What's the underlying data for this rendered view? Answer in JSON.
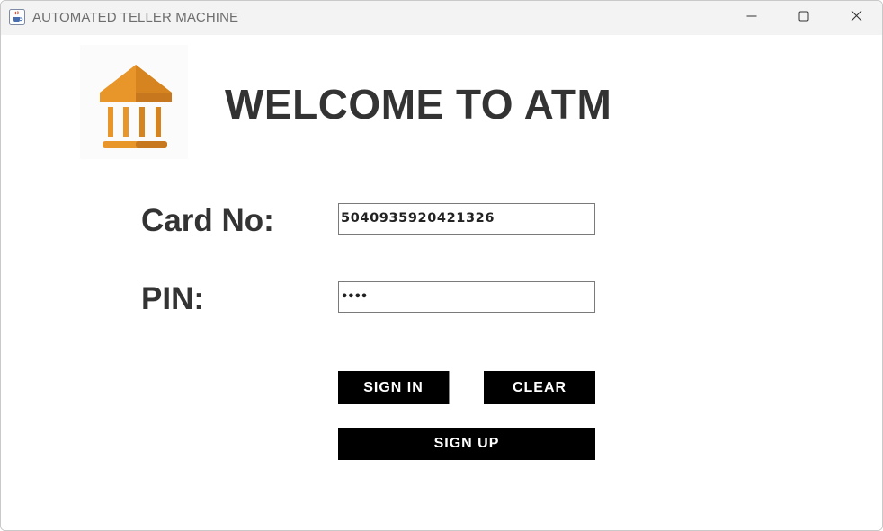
{
  "window": {
    "title": "AUTOMATED TELLER MACHINE",
    "app_icon": "java-cup-icon",
    "controls": {
      "minimize_icon": "minimize-icon",
      "maximize_icon": "maximize-icon",
      "close_icon": "close-icon"
    }
  },
  "header": {
    "logo_icon": "bank-icon",
    "title": "WELCOME TO ATM"
  },
  "form": {
    "card_label": "Card No:",
    "card_value": "5040935920421326",
    "pin_label": "PIN:",
    "pin_value": "••••"
  },
  "buttons": {
    "sign_in": "SIGN IN",
    "clear": "CLEAR",
    "sign_up": "SIGN UP"
  },
  "colors": {
    "logo_orange": "#E8952A",
    "logo_shadow": "#C7771E",
    "button_bg": "#000000",
    "heading_text": "#333333"
  }
}
